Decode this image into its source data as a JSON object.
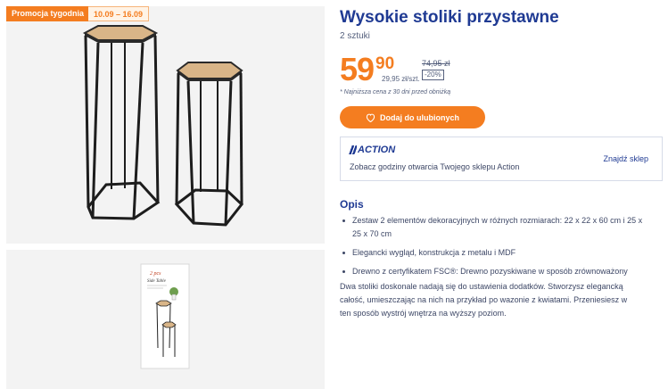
{
  "promo": {
    "label": "Promocja tygodnia",
    "dates": "10.09 – 16.09"
  },
  "product": {
    "title": "Wysokie stoliki przystawne",
    "subtitle": "2 sztuki",
    "price_int": "59",
    "price_dec": "90",
    "unit_price": "29,95 zł/szt.",
    "old_price": "74,95 zł",
    "discount": "-20%",
    "lowest_note": "* Najniższa cena z 30 dni przed obniżką"
  },
  "favorite_button": {
    "label": "Dodaj do ulubionych",
    "icon": "heart-icon"
  },
  "store": {
    "logo": "ACTION",
    "text": "Zobacz godziny otwarcia Twojego sklepu Action",
    "link": "Znajdź sklep"
  },
  "description": {
    "heading": "Opis",
    "bullets": [
      "Zestaw 2 elementów dekoracyjnych w różnych rozmiarach: 22 x 22 x 60 cm i 25 x 25 x 70 cm",
      "Elegancki wygląd, konstrukcja z metalu i MDF",
      "Drewno z certyfikatem FSC®: Drewno pozyskiwane w sposób zrównoważony"
    ],
    "text": "Dwa stoliki doskonale nadają się do ustawienia dodatków. Stworzysz elegancką całość, umieszczając na nich na przykład po wazonie z kwiatami. Przeniesiesz w ten sposób wystrój wnętrza na wyższy poziom."
  },
  "package": {
    "brand": "2 pcs",
    "name": "Side Table"
  },
  "colors": {
    "accent": "#f47d20",
    "brand_blue": "#1f3a93",
    "image_bg": "#f3f3f3"
  }
}
